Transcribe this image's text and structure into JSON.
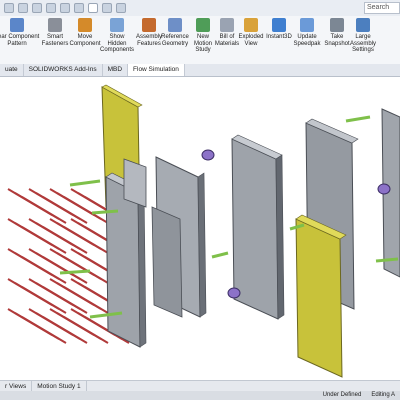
{
  "topbar": {
    "search_placeholder": "Search"
  },
  "ribbon": {
    "buttons": [
      {
        "label": "near Component\nPattern",
        "icon": "linear-pattern-icon",
        "color": "#5b86c9"
      },
      {
        "label": "Smart\nFasteners",
        "icon": "fasteners-icon",
        "color": "#8a8f99"
      },
      {
        "label": "Move\nComponent",
        "icon": "move-component-icon",
        "color": "#d48a2a"
      },
      {
        "label": "Show\nHidden\nComponents",
        "icon": "show-hidden-icon",
        "color": "#7aa3d6"
      },
      {
        "label": "Assembly\nFeatures",
        "icon": "assembly-features-icon",
        "color": "#c46a2e"
      },
      {
        "label": "Reference\nGeometry",
        "icon": "reference-geometry-icon",
        "color": "#6e8fc7"
      },
      {
        "label": "New\nMotion\nStudy",
        "icon": "motion-study-icon",
        "color": "#4f9d58"
      },
      {
        "label": "Bill of\nMaterials",
        "icon": "bill-of-materials-icon",
        "color": "#9aa3b2"
      },
      {
        "label": "Exploded\nView",
        "icon": "exploded-view-icon",
        "color": "#d9a23a"
      },
      {
        "label": "Instant3D",
        "icon": "instant3d-icon",
        "color": "#3f7fd0"
      },
      {
        "label": "Update\nSpeedpak",
        "icon": "speedpak-icon",
        "color": "#6b9ad8"
      },
      {
        "label": "Take\nSnapshot",
        "icon": "snapshot-icon",
        "color": "#7c8794"
      },
      {
        "label": "Large\nAssembly\nSettings",
        "icon": "large-assembly-icon",
        "color": "#4c7fbf"
      }
    ]
  },
  "tabs": [
    {
      "label": "uate",
      "active": false
    },
    {
      "label": "SOLIDWORKS Add-Ins",
      "active": false
    },
    {
      "label": "MBD",
      "active": false
    },
    {
      "label": "Flow Simulation",
      "active": true
    }
  ],
  "bottom_tabs": [
    {
      "label": "r Views"
    },
    {
      "label": "Motion Study 1"
    }
  ],
  "status": {
    "under_defined": "Under Defined",
    "editing": "Editing A"
  },
  "colors": {
    "plate_gray": "#9ea3aa",
    "plate_dark": "#5e636b",
    "accent_yellow": "#c8c23a",
    "pin_green": "#7fc04a",
    "pin_purple": "#8c72c8",
    "spring_red": "#b03a3a"
  }
}
